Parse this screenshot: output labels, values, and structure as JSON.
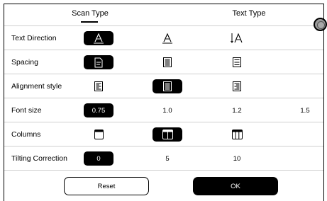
{
  "tabs": [
    {
      "label": "Scan Type",
      "active": true
    },
    {
      "label": "Text Type",
      "active": false
    }
  ],
  "rows": [
    {
      "label": "Text Direction",
      "options": [
        {
          "icon": "text-direction-horizontal-icon",
          "selected": true
        },
        {
          "icon": "text-direction-horizontal-icon",
          "selected": false
        },
        {
          "icon": "text-direction-vertical-icon",
          "selected": false
        }
      ]
    },
    {
      "label": "Spacing",
      "options": [
        {
          "icon": "page-spacing-icon",
          "selected": true
        },
        {
          "icon": "lines-dense-icon",
          "selected": false
        },
        {
          "icon": "lines-sparse-icon",
          "selected": false
        }
      ]
    },
    {
      "label": "Alignment style",
      "options": [
        {
          "icon": "align-left-icon",
          "selected": false
        },
        {
          "icon": "align-justify-icon",
          "selected": true
        },
        {
          "icon": "align-right-icon",
          "selected": false
        }
      ]
    },
    {
      "label": "Font size",
      "options": [
        {
          "text": "0.75",
          "selected": true
        },
        {
          "text": "1.0",
          "selected": false
        },
        {
          "text": "1.2",
          "selected": false
        },
        {
          "text": "1.5",
          "selected": false
        }
      ]
    },
    {
      "label": "Columns",
      "options": [
        {
          "icon": "single-column-icon",
          "selected": false
        },
        {
          "icon": "two-columns-icon",
          "selected": true
        },
        {
          "icon": "three-columns-icon",
          "selected": false
        }
      ]
    },
    {
      "label": "Tilting Correction",
      "options": [
        {
          "text": "0",
          "selected": true
        },
        {
          "text": "5",
          "selected": false
        },
        {
          "text": "10",
          "selected": false
        }
      ]
    }
  ],
  "buttons": {
    "reset": "Reset",
    "ok": "OK"
  }
}
